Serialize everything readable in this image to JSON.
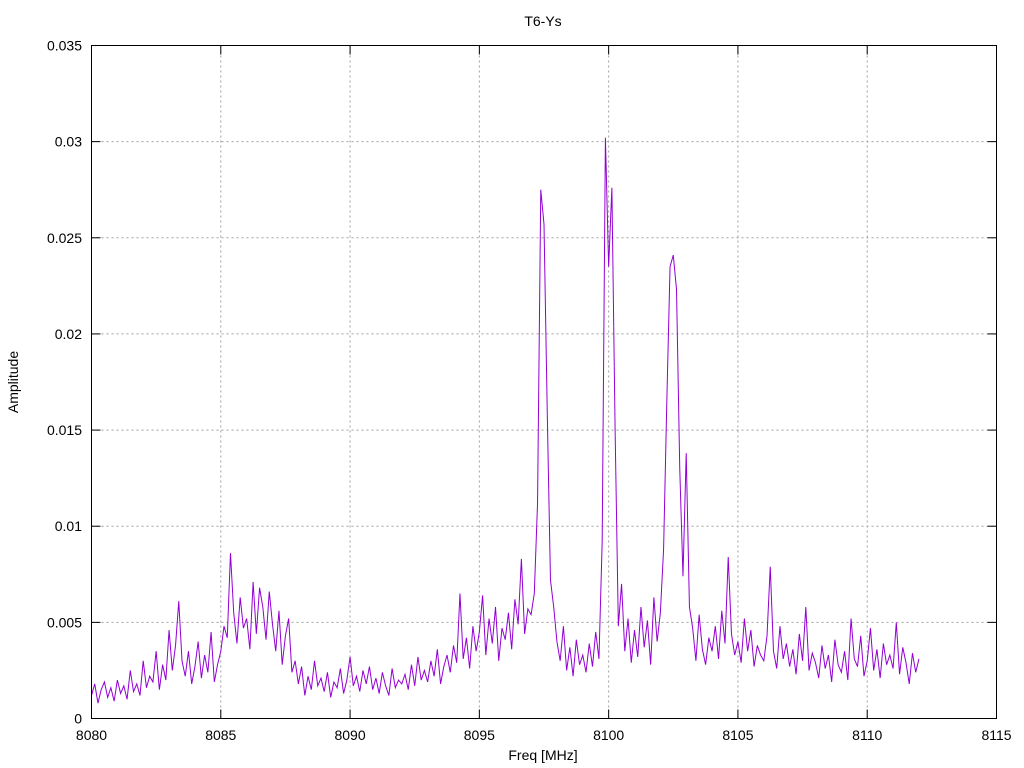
{
  "chart_data": {
    "type": "line",
    "title": "T6-Ys",
    "xlabel": "Freq [MHz]",
    "ylabel": "Amplitude",
    "xlim": [
      8080,
      8115
    ],
    "ylim": [
      0,
      0.035
    ],
    "xticks": [
      "8080",
      "8085",
      "8090",
      "8095",
      "8100",
      "8105",
      "8110",
      "8115"
    ],
    "yticks": [
      "0",
      "0.005",
      "0.01",
      "0.015",
      "0.02",
      "0.025",
      "0.03",
      "0.035"
    ],
    "grid": true,
    "legend": "none",
    "series": [
      {
        "name": "T6-Ys",
        "color": "#9400d3",
        "x_start": 8080,
        "x_step": 0.125,
        "y": [
          0.0012,
          0.0018,
          0.0008,
          0.0015,
          0.0019,
          0.0011,
          0.0016,
          0.0009,
          0.002,
          0.0013,
          0.0017,
          0.001,
          0.0025,
          0.0014,
          0.0018,
          0.0012,
          0.003,
          0.0016,
          0.0022,
          0.0019,
          0.0035,
          0.0015,
          0.0028,
          0.002,
          0.0046,
          0.0025,
          0.0038,
          0.0061,
          0.003,
          0.0022,
          0.0035,
          0.0018,
          0.0027,
          0.004,
          0.0021,
          0.0033,
          0.0024,
          0.0045,
          0.0019,
          0.0028,
          0.0035,
          0.0048,
          0.0042,
          0.0086,
          0.0055,
          0.0039,
          0.0063,
          0.0047,
          0.0052,
          0.0036,
          0.0071,
          0.0044,
          0.0068,
          0.0058,
          0.0041,
          0.0066,
          0.0049,
          0.0035,
          0.0056,
          0.0028,
          0.0043,
          0.0052,
          0.0024,
          0.003,
          0.0018,
          0.0027,
          0.0012,
          0.0022,
          0.0015,
          0.003,
          0.0017,
          0.0021,
          0.0014,
          0.0024,
          0.0011,
          0.0019,
          0.0016,
          0.0026,
          0.0013,
          0.002,
          0.0032,
          0.0017,
          0.0022,
          0.0014,
          0.0025,
          0.0018,
          0.0027,
          0.0015,
          0.0021,
          0.0013,
          0.0024,
          0.0017,
          0.0012,
          0.0026,
          0.0016,
          0.002,
          0.0018,
          0.0023,
          0.0015,
          0.0028,
          0.0017,
          0.0032,
          0.002,
          0.0025,
          0.0019,
          0.003,
          0.0022,
          0.0036,
          0.0018,
          0.0027,
          0.0033,
          0.0024,
          0.0038,
          0.0029,
          0.0065,
          0.0031,
          0.0042,
          0.0026,
          0.0048,
          0.0035,
          0.0045,
          0.0064,
          0.0033,
          0.0052,
          0.0039,
          0.0058,
          0.003,
          0.0047,
          0.0041,
          0.0055,
          0.0036,
          0.0062,
          0.0049,
          0.0083,
          0.0044,
          0.0057,
          0.0054,
          0.0065,
          0.0112,
          0.0275,
          0.0257,
          0.016,
          0.0072,
          0.0058,
          0.004,
          0.003,
          0.0048,
          0.0025,
          0.0037,
          0.0022,
          0.0041,
          0.0028,
          0.0033,
          0.0024,
          0.0039,
          0.0027,
          0.0045,
          0.0031,
          0.0092,
          0.0302,
          0.0235,
          0.0276,
          0.015,
          0.0048,
          0.007,
          0.0035,
          0.0052,
          0.0029,
          0.0046,
          0.0032,
          0.0058,
          0.0037,
          0.0051,
          0.0028,
          0.0063,
          0.004,
          0.0055,
          0.0088,
          0.0165,
          0.0235,
          0.0241,
          0.0223,
          0.013,
          0.0074,
          0.0138,
          0.0058,
          0.0047,
          0.003,
          0.0054,
          0.0036,
          0.0028,
          0.0042,
          0.0035,
          0.0048,
          0.0031,
          0.0056,
          0.0039,
          0.0084,
          0.0044,
          0.0033,
          0.004,
          0.0029,
          0.0052,
          0.0035,
          0.0046,
          0.0027,
          0.0038,
          0.0033,
          0.003,
          0.0043,
          0.0079,
          0.0035,
          0.0026,
          0.0048,
          0.0031,
          0.0039,
          0.0027,
          0.0036,
          0.0023,
          0.0044,
          0.003,
          0.0058,
          0.0025,
          0.0034,
          0.0029,
          0.0021,
          0.0038,
          0.0026,
          0.0033,
          0.0019,
          0.0041,
          0.0028,
          0.0024,
          0.0035,
          0.002,
          0.0052,
          0.0031,
          0.0027,
          0.0043,
          0.0022,
          0.003,
          0.0047,
          0.0025,
          0.0036,
          0.0021,
          0.0039,
          0.0028,
          0.0033,
          0.0026,
          0.005,
          0.0023,
          0.0037,
          0.0029,
          0.0018,
          0.0034,
          0.0024,
          0.0031
        ]
      }
    ]
  }
}
